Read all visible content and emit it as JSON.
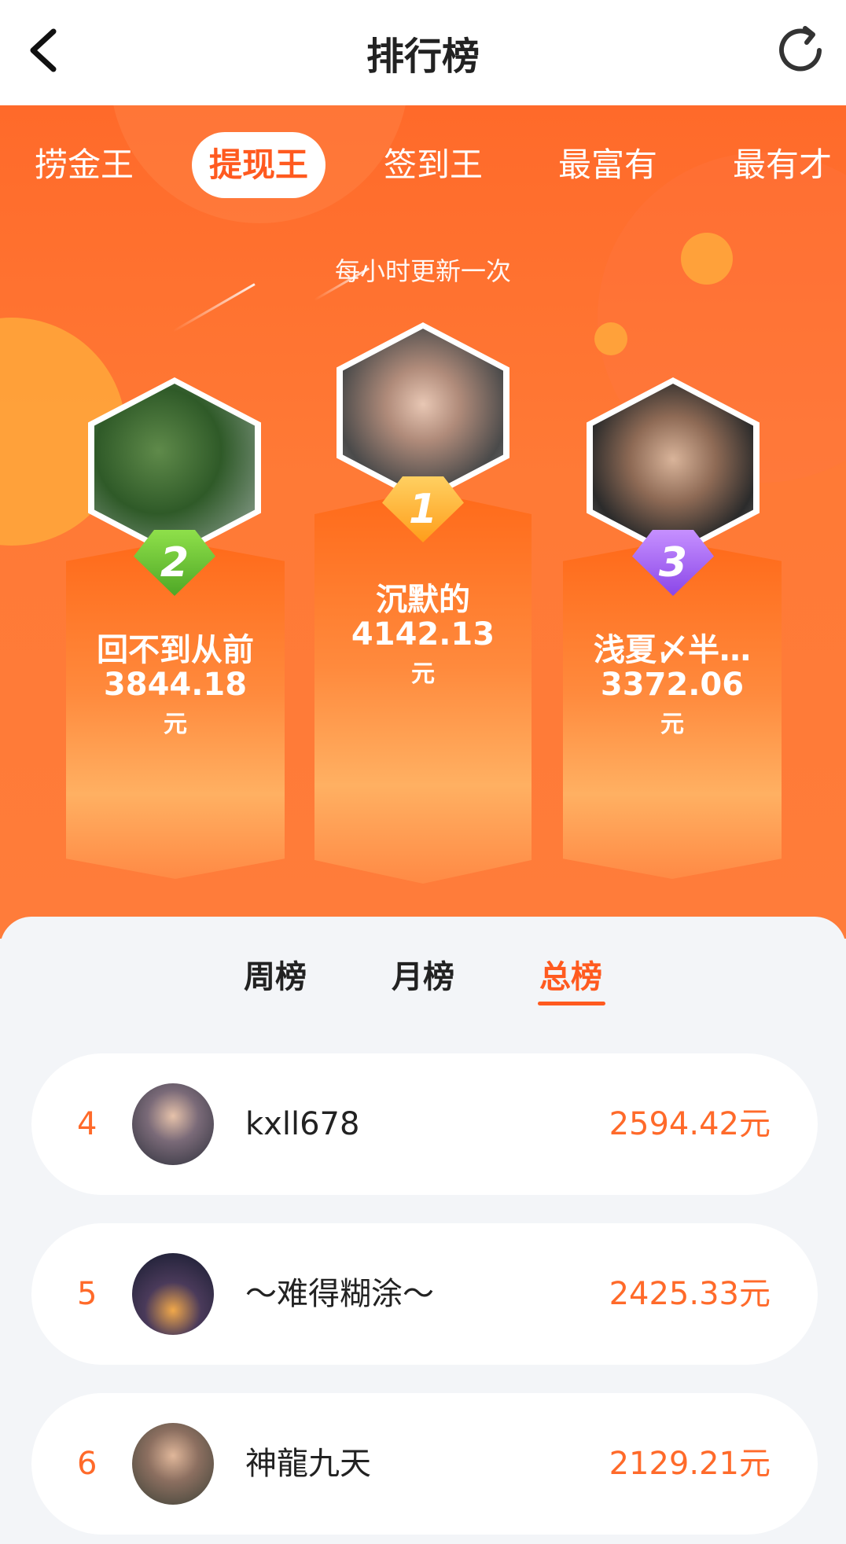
{
  "header": {
    "title": "排行榜",
    "back_icon": "chevron-left-icon",
    "refresh_icon": "refresh-icon"
  },
  "category_tabs": [
    {
      "label": "捞金王",
      "active": false
    },
    {
      "label": "提现王",
      "active": true
    },
    {
      "label": "签到王",
      "active": false
    },
    {
      "label": "最富有",
      "active": false
    },
    {
      "label": "最有才",
      "active": false
    }
  ],
  "update_note": "每小时更新一次",
  "podium": {
    "first": {
      "rank": "1",
      "name": "沉默的",
      "amount": "4142.13",
      "unit": "元"
    },
    "second": {
      "rank": "2",
      "name": "回不到从前",
      "amount": "3844.18",
      "unit": "元"
    },
    "third": {
      "rank": "3",
      "name": "浅夏〆半…",
      "amount": "3372.06",
      "unit": "元"
    }
  },
  "period_tabs": [
    {
      "label": "周榜",
      "active": false
    },
    {
      "label": "月榜",
      "active": false
    },
    {
      "label": "总榜",
      "active": true
    }
  ],
  "list": [
    {
      "rank": "4",
      "name": "kxll678",
      "amount": "2594.42元"
    },
    {
      "rank": "5",
      "name": "～难得糊涂～",
      "amount": "2425.33元"
    },
    {
      "rank": "6",
      "name": "神龍九天",
      "amount": "2129.21元"
    }
  ],
  "colors": {
    "accent": "#ff5a1f",
    "amount": "#ff6a2a",
    "badge_first": "#ffa020",
    "badge_second": "#6cc23a",
    "badge_third": "#9b5cf0"
  }
}
